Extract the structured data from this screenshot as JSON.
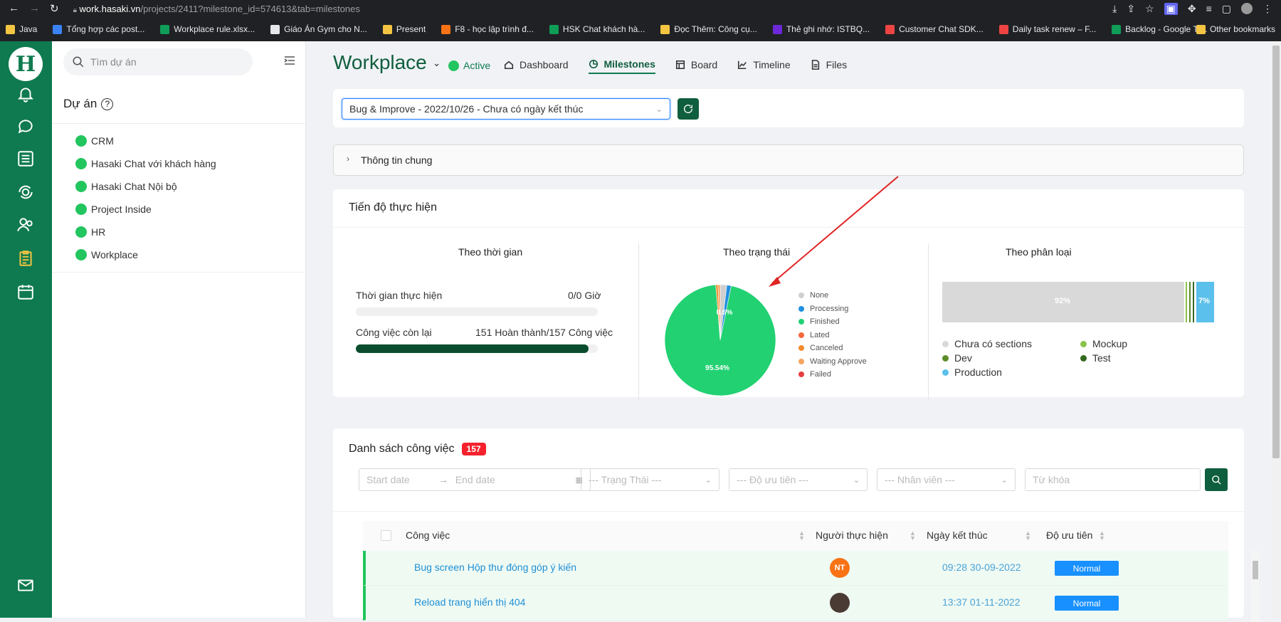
{
  "browser": {
    "url_host": "work.hasaki.vn",
    "url_path": "/projects/2411?milestone_id=574613&tab=milestones"
  },
  "bookmarks": [
    {
      "label": "Java",
      "color": "#f4c542"
    },
    {
      "label": "Tổng hợp các post...",
      "color": "#3b82f6"
    },
    {
      "label": "Workplace rule.xlsx...",
      "color": "#0f9d58"
    },
    {
      "label": "Giáo Án Gym cho N...",
      "color": "#e5e7eb"
    },
    {
      "label": "Present",
      "color": "#f4c542"
    },
    {
      "label": "F8 - học lập trình đ...",
      "color": "#f97316"
    },
    {
      "label": "HSK Chat khách hà...",
      "color": "#0f9d58"
    },
    {
      "label": "Đọc Thêm: Công cụ...",
      "color": "#f4c542"
    },
    {
      "label": "Thẻ ghi nhớ: ISTBQ...",
      "color": "#6d28d9"
    },
    {
      "label": "Customer Chat SDK...",
      "color": "#ef4444"
    },
    {
      "label": "Daily task renew – F...",
      "color": "#ef4444"
    },
    {
      "label": "Backlog - Google Tr...",
      "color": "#0f9d58"
    }
  ],
  "bookmarks_other": "Other bookmarks",
  "sidebar": {
    "search_placeholder": "Tìm dự án",
    "title": "Dự án",
    "projects": [
      "CRM",
      "Hasaki Chat với khách hàng",
      "Hasaki Chat Nội bộ",
      "Project Inside",
      "HR",
      "Workplace"
    ]
  },
  "header": {
    "title": "Workplace",
    "status": "Active",
    "tabs": [
      "Dashboard",
      "Milestones",
      "Board",
      "Timeline",
      "Files"
    ],
    "active_tab": "Milestones"
  },
  "milestone_select": "Bug & Improve - 2022/10/26 - Chưa có ngày kết thúc",
  "general_info": "Thông tin chung",
  "progress": {
    "title": "Tiến độ thực hiện",
    "by_time": {
      "title": "Theo thời gian",
      "duration_label": "Thời gian thực hiện",
      "duration_value": "0/0 Giờ",
      "duration_fraction": 0,
      "remaining_label": "Công việc còn lại",
      "remaining_value": "151 Hoàn thành/157 Công việc",
      "remaining_fraction": 0.9618
    },
    "by_status": {
      "title": "Theo trạng thái",
      "center_label": "0.6%",
      "main_label": "95.54%"
    },
    "by_category": {
      "title": "Theo phân loại",
      "bar_left_label": "92%",
      "bar_right_label": "7%",
      "legend": [
        {
          "label": "Chưa có sections",
          "color": "#d9d9d9"
        },
        {
          "label": "Mockup",
          "color": "#8bc34a"
        },
        {
          "label": "Dev",
          "color": "#5b8c2a"
        },
        {
          "label": "Test",
          "color": "#33691e"
        },
        {
          "label": "Production",
          "color": "#5bc0eb"
        }
      ]
    }
  },
  "chart_data": {
    "type": "pie",
    "title": "Theo trạng thái",
    "slices": [
      {
        "name": "None",
        "value": 1.91,
        "color": "#cfcfcf"
      },
      {
        "name": "Processing",
        "value": 1.27,
        "color": "#1f8fe0"
      },
      {
        "name": "Finished",
        "value": 95.54,
        "color": "#22d172"
      },
      {
        "name": "Lated",
        "value": 0.0,
        "color": "#f4683c"
      },
      {
        "name": "Canceled",
        "value": 0.64,
        "color": "#f28a2e"
      },
      {
        "name": "Waiting Approve",
        "value": 0.64,
        "color": "#f4a460"
      },
      {
        "name": "Failed",
        "value": 0.0,
        "color": "#e53e3e"
      }
    ],
    "legend_position": "right"
  },
  "tasks": {
    "title": "Danh sách công việc",
    "count": "157",
    "filters": {
      "start_date": "Start date",
      "end_date": "End date",
      "status": "--- Trạng Thái ---",
      "priority": "--- Độ ưu tiên ---",
      "staff": "--- Nhân viên ---",
      "keyword": "Từ khóa"
    },
    "columns": [
      "Công việc",
      "Người thực hiện",
      "Ngày kết thúc",
      "Độ ưu tiên"
    ],
    "rows": [
      {
        "task": "Bug screen Hộp thư đóng góp ý kiến",
        "assignee": "NT",
        "assignee_color": "#f97316",
        "end": "09:28 30-09-2022",
        "priority": "Normal"
      },
      {
        "task": "Reload trang hiển thị 404",
        "assignee": "",
        "assignee_color": "#4b3b35",
        "end": "13:37 01-11-2022",
        "priority": "Normal"
      }
    ]
  }
}
